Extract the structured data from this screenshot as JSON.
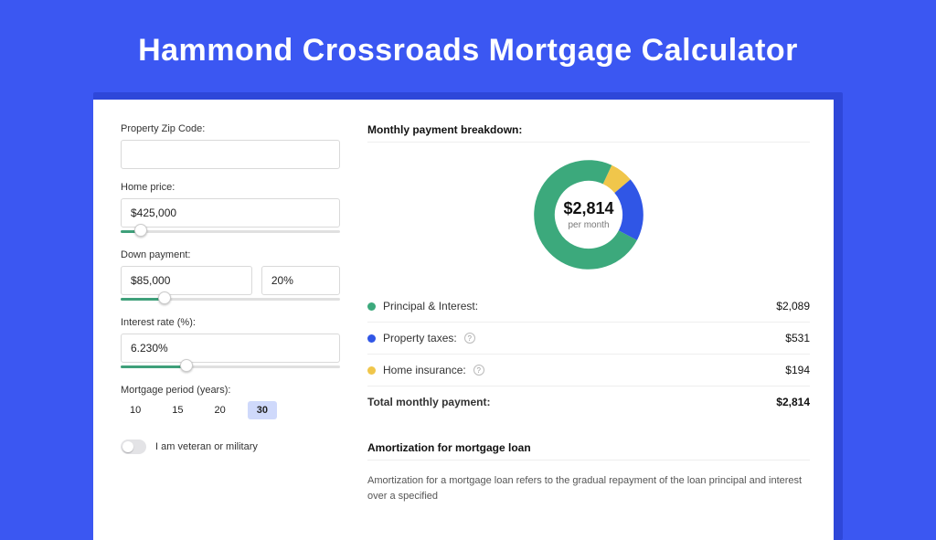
{
  "title": "Hammond Crossroads Mortgage Calculator",
  "form": {
    "zip_label": "Property Zip Code:",
    "zip_value": "",
    "home_price_label": "Home price:",
    "home_price_value": "$425,000",
    "home_price_slider_pct": 9,
    "down_payment_label": "Down payment:",
    "down_payment_value": "$85,000",
    "down_payment_pct_value": "20%",
    "down_payment_slider_pct": 20,
    "rate_label": "Interest rate (%):",
    "rate_value": "6.230%",
    "rate_slider_pct": 30,
    "period_label": "Mortgage period (years):",
    "periods": [
      "10",
      "15",
      "20",
      "30"
    ],
    "selected_period_index": 3,
    "veteran_label": "I am veteran or military"
  },
  "breakdown": {
    "title": "Monthly payment breakdown:",
    "center_amount": "$2,814",
    "center_sub": "per month",
    "items": [
      {
        "label": "Principal & Interest:",
        "value": "$2,089",
        "color": "#3CA97C",
        "help": false
      },
      {
        "label": "Property taxes:",
        "value": "$531",
        "color": "#3056E6",
        "help": true
      },
      {
        "label": "Home insurance:",
        "value": "$194",
        "color": "#F0C64B",
        "help": true
      }
    ],
    "total_label": "Total monthly payment:",
    "total_value": "$2,814"
  },
  "chart_data": {
    "type": "pie",
    "title": "Monthly payment breakdown",
    "series": [
      {
        "name": "Principal & Interest",
        "value": 2089,
        "color": "#3CA97C"
      },
      {
        "name": "Property taxes",
        "value": 531,
        "color": "#3056E6"
      },
      {
        "name": "Home insurance",
        "value": 194,
        "color": "#F0C64B"
      }
    ],
    "total": 2814,
    "center_label": "$2,814",
    "center_sub": "per month",
    "donut_inner_ratio": 0.62
  },
  "amortization": {
    "title": "Amortization for mortgage loan",
    "text": "Amortization for a mortgage loan refers to the gradual repayment of the loan principal and interest over a specified"
  }
}
